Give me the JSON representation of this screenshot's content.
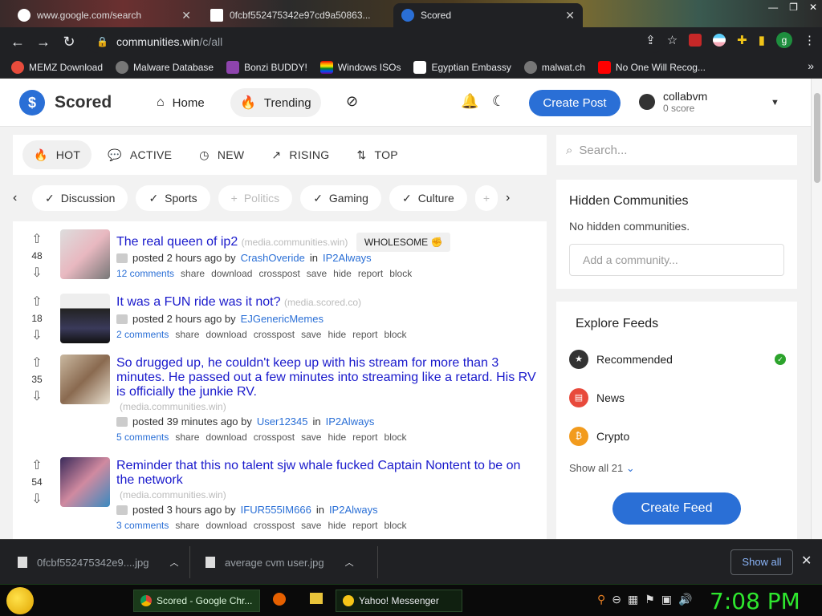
{
  "browser": {
    "tabs": [
      {
        "title": "www.google.com/search",
        "active": false
      },
      {
        "title": "0fcbf552475342e97cd9a50863...",
        "active": false
      },
      {
        "title": "Scored",
        "active": true
      }
    ],
    "url_host": "communities.win",
    "url_path": "/c/all",
    "profile_letter": "g",
    "bookmarks": [
      "MEMZ Download",
      "Malware Database",
      "Bonzi BUDDY!",
      "Windows ISOs",
      "Egyptian Embassy",
      "malwat.ch",
      "No One Will Recog..."
    ]
  },
  "site": {
    "logo": "Scored",
    "nav": [
      "Home",
      "Trending"
    ],
    "create_post": "Create Post",
    "user_name": "collabvm",
    "user_score": "0 score"
  },
  "sort_tabs": [
    "HOT",
    "ACTIVE",
    "NEW",
    "RISING",
    "TOP"
  ],
  "filters": [
    {
      "label": "Discussion",
      "on": true
    },
    {
      "label": "Sports",
      "on": true
    },
    {
      "label": "Politics",
      "on": false
    },
    {
      "label": "Gaming",
      "on": true
    },
    {
      "label": "Culture",
      "on": true
    }
  ],
  "posts": [
    {
      "votes": "48",
      "title": "The real queen of ip2",
      "domain": "(media.communities.win)",
      "tag": "WHOLESOME ✊",
      "posted": "posted 2 hours ago by",
      "author": "CrashOveride",
      "in": "in",
      "community": "IP2Always",
      "comments": "12 comments"
    },
    {
      "votes": "18",
      "title": "It was a FUN ride was it not?",
      "domain": "(media.scored.co)",
      "tag": "",
      "posted": "posted 2 hours ago by",
      "author": "EJGenericMemes",
      "in": "",
      "community": "",
      "comments": "2 comments"
    },
    {
      "votes": "35",
      "title": "So drugged up, he couldn't keep up with his stream for more than 3 minutes. He passed out a few minutes into streaming like a retard. His RV is officially the junkie RV.",
      "domain": "(media.communities.win)",
      "tag": "",
      "posted": "posted 39 minutes ago by",
      "author": "User12345",
      "in": "in",
      "community": "IP2Always",
      "comments": "5 comments"
    },
    {
      "votes": "54",
      "title": "Reminder that this no talent sjw whale fucked Captain Nontent to be on the network",
      "domain": "(media.communities.win)",
      "tag": "",
      "posted": "posted 3 hours ago by",
      "author": "IFUR555IM666",
      "in": "in",
      "community": "IP2Always",
      "comments": "3 comments"
    }
  ],
  "post_actions": [
    "share",
    "download",
    "crosspost",
    "save",
    "hide",
    "report",
    "block"
  ],
  "sidebar": {
    "search_placeholder": "Search...",
    "hidden_title": "Hidden Communities",
    "hidden_empty": "No hidden communities.",
    "add_placeholder": "Add a community...",
    "explore_title": "Explore Feeds",
    "feeds": [
      {
        "label": "Recommended",
        "color": "#333333",
        "icon": "★"
      },
      {
        "label": "News",
        "color": "#e84a3c",
        "icon": "▤"
      },
      {
        "label": "Crypto",
        "color": "#f29b1d",
        "icon": "₿"
      }
    ],
    "show_all": "Show all 21",
    "create_feed": "Create Feed"
  },
  "downloads": [
    {
      "name": "0fcbf552475342e9....jpg"
    },
    {
      "name": "average cvm user.jpg"
    }
  ],
  "downloads_show_all": "Show all",
  "taskbar": {
    "tasks": [
      "Scored - Google Chr...",
      "Yahoo! Messenger"
    ],
    "clock": "7:08 PM"
  }
}
